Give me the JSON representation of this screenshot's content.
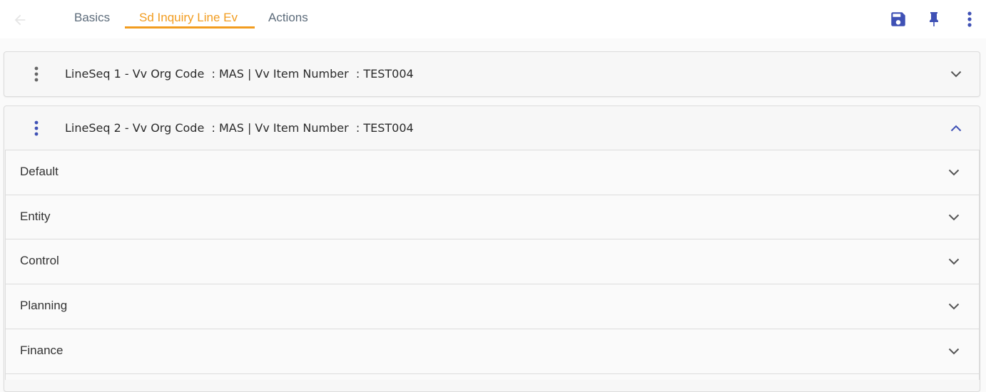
{
  "header": {
    "back_icon": "arrow-left-icon",
    "tabs": [
      {
        "label": "Basics",
        "active": false
      },
      {
        "label": "Sd Inquiry Line Ev",
        "active": true
      },
      {
        "label": "Actions",
        "active": false
      }
    ],
    "actions": {
      "save_icon": "save-icon",
      "pin_icon": "pin-icon",
      "more_icon": "more-vertical-icon"
    }
  },
  "lines": [
    {
      "title": "LineSeq 1 - Vv Org Code  : MAS | Vv Item Number  : TEST004",
      "expanded": false
    },
    {
      "title": "LineSeq 2 - Vv Org Code  : MAS | Vv Item Number  : TEST004",
      "expanded": true
    }
  ],
  "sections": [
    {
      "label": "Default"
    },
    {
      "label": "Entity"
    },
    {
      "label": "Control"
    },
    {
      "label": "Planning"
    },
    {
      "label": "Finance"
    }
  ],
  "colors": {
    "accent": "#f29c1f",
    "primary_icon": "#3f51b5",
    "tab_inactive": "#5c6b7a",
    "chevron": "#555555"
  }
}
